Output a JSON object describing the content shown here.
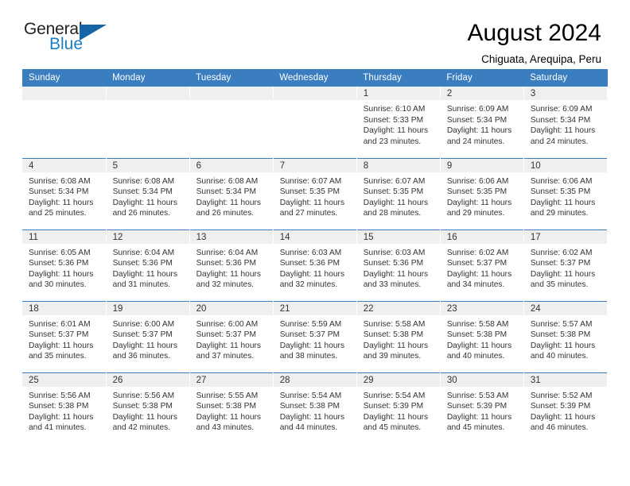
{
  "brand": {
    "name_part1": "General",
    "name_part2": "Blue",
    "accent_color": "#1b7fc4",
    "triangle_color": "#1565a6"
  },
  "header": {
    "title": "August 2024",
    "subtitle": "Chiguata, Arequipa, Peru"
  },
  "calendar": {
    "header_bg": "#3b7ec0",
    "daynum_bg": "#efefef",
    "weekdays": [
      "Sunday",
      "Monday",
      "Tuesday",
      "Wednesday",
      "Thursday",
      "Friday",
      "Saturday"
    ],
    "labels": {
      "sunrise": "Sunrise:",
      "sunset": "Sunset:",
      "daylight": "Daylight:"
    },
    "weeks": [
      [
        {
          "day": ""
        },
        {
          "day": ""
        },
        {
          "day": ""
        },
        {
          "day": ""
        },
        {
          "day": "1",
          "sunrise": "6:10 AM",
          "sunset": "5:33 PM",
          "daylight_l1": "Daylight: 11 hours",
          "daylight_l2": "and 23 minutes."
        },
        {
          "day": "2",
          "sunrise": "6:09 AM",
          "sunset": "5:34 PM",
          "daylight_l1": "Daylight: 11 hours",
          "daylight_l2": "and 24 minutes."
        },
        {
          "day": "3",
          "sunrise": "6:09 AM",
          "sunset": "5:34 PM",
          "daylight_l1": "Daylight: 11 hours",
          "daylight_l2": "and 24 minutes."
        }
      ],
      [
        {
          "day": "4",
          "sunrise": "6:08 AM",
          "sunset": "5:34 PM",
          "daylight_l1": "Daylight: 11 hours",
          "daylight_l2": "and 25 minutes."
        },
        {
          "day": "5",
          "sunrise": "6:08 AM",
          "sunset": "5:34 PM",
          "daylight_l1": "Daylight: 11 hours",
          "daylight_l2": "and 26 minutes."
        },
        {
          "day": "6",
          "sunrise": "6:08 AM",
          "sunset": "5:34 PM",
          "daylight_l1": "Daylight: 11 hours",
          "daylight_l2": "and 26 minutes."
        },
        {
          "day": "7",
          "sunrise": "6:07 AM",
          "sunset": "5:35 PM",
          "daylight_l1": "Daylight: 11 hours",
          "daylight_l2": "and 27 minutes."
        },
        {
          "day": "8",
          "sunrise": "6:07 AM",
          "sunset": "5:35 PM",
          "daylight_l1": "Daylight: 11 hours",
          "daylight_l2": "and 28 minutes."
        },
        {
          "day": "9",
          "sunrise": "6:06 AM",
          "sunset": "5:35 PM",
          "daylight_l1": "Daylight: 11 hours",
          "daylight_l2": "and 29 minutes."
        },
        {
          "day": "10",
          "sunrise": "6:06 AM",
          "sunset": "5:35 PM",
          "daylight_l1": "Daylight: 11 hours",
          "daylight_l2": "and 29 minutes."
        }
      ],
      [
        {
          "day": "11",
          "sunrise": "6:05 AM",
          "sunset": "5:36 PM",
          "daylight_l1": "Daylight: 11 hours",
          "daylight_l2": "and 30 minutes."
        },
        {
          "day": "12",
          "sunrise": "6:04 AM",
          "sunset": "5:36 PM",
          "daylight_l1": "Daylight: 11 hours",
          "daylight_l2": "and 31 minutes."
        },
        {
          "day": "13",
          "sunrise": "6:04 AM",
          "sunset": "5:36 PM",
          "daylight_l1": "Daylight: 11 hours",
          "daylight_l2": "and 32 minutes."
        },
        {
          "day": "14",
          "sunrise": "6:03 AM",
          "sunset": "5:36 PM",
          "daylight_l1": "Daylight: 11 hours",
          "daylight_l2": "and 32 minutes."
        },
        {
          "day": "15",
          "sunrise": "6:03 AM",
          "sunset": "5:36 PM",
          "daylight_l1": "Daylight: 11 hours",
          "daylight_l2": "and 33 minutes."
        },
        {
          "day": "16",
          "sunrise": "6:02 AM",
          "sunset": "5:37 PM",
          "daylight_l1": "Daylight: 11 hours",
          "daylight_l2": "and 34 minutes."
        },
        {
          "day": "17",
          "sunrise": "6:02 AM",
          "sunset": "5:37 PM",
          "daylight_l1": "Daylight: 11 hours",
          "daylight_l2": "and 35 minutes."
        }
      ],
      [
        {
          "day": "18",
          "sunrise": "6:01 AM",
          "sunset": "5:37 PM",
          "daylight_l1": "Daylight: 11 hours",
          "daylight_l2": "and 35 minutes."
        },
        {
          "day": "19",
          "sunrise": "6:00 AM",
          "sunset": "5:37 PM",
          "daylight_l1": "Daylight: 11 hours",
          "daylight_l2": "and 36 minutes."
        },
        {
          "day": "20",
          "sunrise": "6:00 AM",
          "sunset": "5:37 PM",
          "daylight_l1": "Daylight: 11 hours",
          "daylight_l2": "and 37 minutes."
        },
        {
          "day": "21",
          "sunrise": "5:59 AM",
          "sunset": "5:37 PM",
          "daylight_l1": "Daylight: 11 hours",
          "daylight_l2": "and 38 minutes."
        },
        {
          "day": "22",
          "sunrise": "5:58 AM",
          "sunset": "5:38 PM",
          "daylight_l1": "Daylight: 11 hours",
          "daylight_l2": "and 39 minutes."
        },
        {
          "day": "23",
          "sunrise": "5:58 AM",
          "sunset": "5:38 PM",
          "daylight_l1": "Daylight: 11 hours",
          "daylight_l2": "and 40 minutes."
        },
        {
          "day": "24",
          "sunrise": "5:57 AM",
          "sunset": "5:38 PM",
          "daylight_l1": "Daylight: 11 hours",
          "daylight_l2": "and 40 minutes."
        }
      ],
      [
        {
          "day": "25",
          "sunrise": "5:56 AM",
          "sunset": "5:38 PM",
          "daylight_l1": "Daylight: 11 hours",
          "daylight_l2": "and 41 minutes."
        },
        {
          "day": "26",
          "sunrise": "5:56 AM",
          "sunset": "5:38 PM",
          "daylight_l1": "Daylight: 11 hours",
          "daylight_l2": "and 42 minutes."
        },
        {
          "day": "27",
          "sunrise": "5:55 AM",
          "sunset": "5:38 PM",
          "daylight_l1": "Daylight: 11 hours",
          "daylight_l2": "and 43 minutes."
        },
        {
          "day": "28",
          "sunrise": "5:54 AM",
          "sunset": "5:38 PM",
          "daylight_l1": "Daylight: 11 hours",
          "daylight_l2": "and 44 minutes."
        },
        {
          "day": "29",
          "sunrise": "5:54 AM",
          "sunset": "5:39 PM",
          "daylight_l1": "Daylight: 11 hours",
          "daylight_l2": "and 45 minutes."
        },
        {
          "day": "30",
          "sunrise": "5:53 AM",
          "sunset": "5:39 PM",
          "daylight_l1": "Daylight: 11 hours",
          "daylight_l2": "and 45 minutes."
        },
        {
          "day": "31",
          "sunrise": "5:52 AM",
          "sunset": "5:39 PM",
          "daylight_l1": "Daylight: 11 hours",
          "daylight_l2": "and 46 minutes."
        }
      ]
    ]
  }
}
